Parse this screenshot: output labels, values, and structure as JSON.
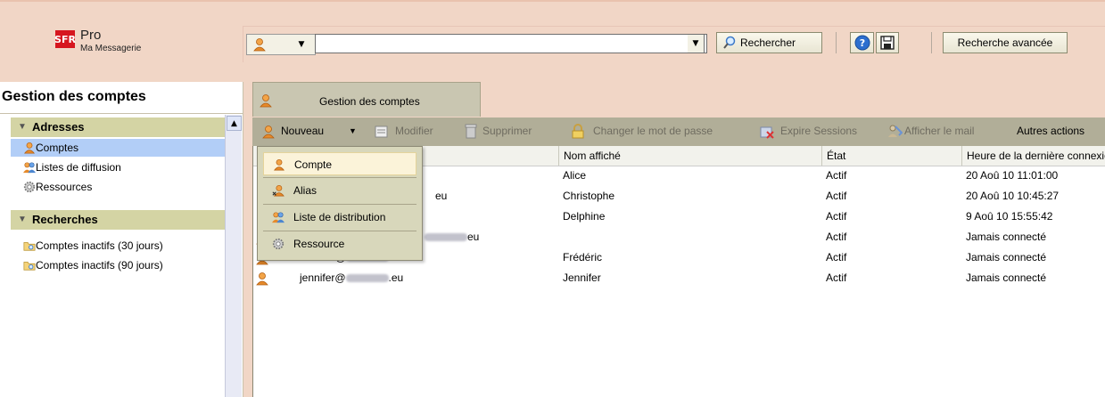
{
  "header": {
    "logo_mark": "SFR",
    "logo_title": "Pro",
    "logo_subtitle": "Ma Messagerie",
    "search_value": "",
    "search_button": "Rechercher",
    "advanced_button": "Recherche avancée"
  },
  "left": {
    "title": "Gestion des comptes",
    "section_addresses": "Adresses",
    "items_addresses": [
      "Comptes",
      "Listes de diffusion",
      "Ressources"
    ],
    "section_searches": "Recherches",
    "items_searches": [
      "Comptes inactifs (30 jours)",
      "Comptes inactifs (90 jours)"
    ]
  },
  "main": {
    "tab_label": "Gestion des comptes",
    "toolbar": {
      "new": "Nouveau",
      "modify": "Modifier",
      "delete": "Supprimer",
      "change_password": "Changer le mot de passe",
      "expire_sessions": "Expire Sessions",
      "show_mail": "Afficher le mail",
      "other_actions": "Autres actions"
    },
    "columns": [
      "Nom affiché",
      "État",
      "Heure de la dernière connexion"
    ],
    "rows": [
      {
        "email_prefix": "",
        "email_suffix": "",
        "name": "Alice",
        "state": "Actif",
        "last": "20 Aoû 10 11:01:00"
      },
      {
        "email_prefix": "",
        "email_suffix": "eu",
        "name": "Christophe",
        "state": "Actif",
        "last": "20 Aoû 10 10:45:27"
      },
      {
        "email_prefix": "",
        "email_suffix": "",
        "name": "Delphine",
        "state": "Actif",
        "last": "9 Aoû 10 15:55:42"
      },
      {
        "email_prefix": "",
        "email_suffix": "eu",
        "name": "",
        "state": "Actif",
        "last": "Jamais connecté"
      },
      {
        "email_prefix": "frederic@",
        "email_suffix": ".eu",
        "name": "Frédéric",
        "state": "Actif",
        "last": "Jamais connecté"
      },
      {
        "email_prefix": "jennifer@",
        "email_suffix": ".eu",
        "name": "Jennifer",
        "state": "Actif",
        "last": "Jamais connecté"
      }
    ]
  },
  "menu": {
    "items": [
      "Compte",
      "Alias",
      "Liste de distribution",
      "Ressource"
    ]
  },
  "colors": {
    "brand": "#d6161f",
    "background": "#f1d6c6",
    "section": "#d4d4a4",
    "toolbar": "#b1ae98",
    "selection": "#b2cef7"
  }
}
